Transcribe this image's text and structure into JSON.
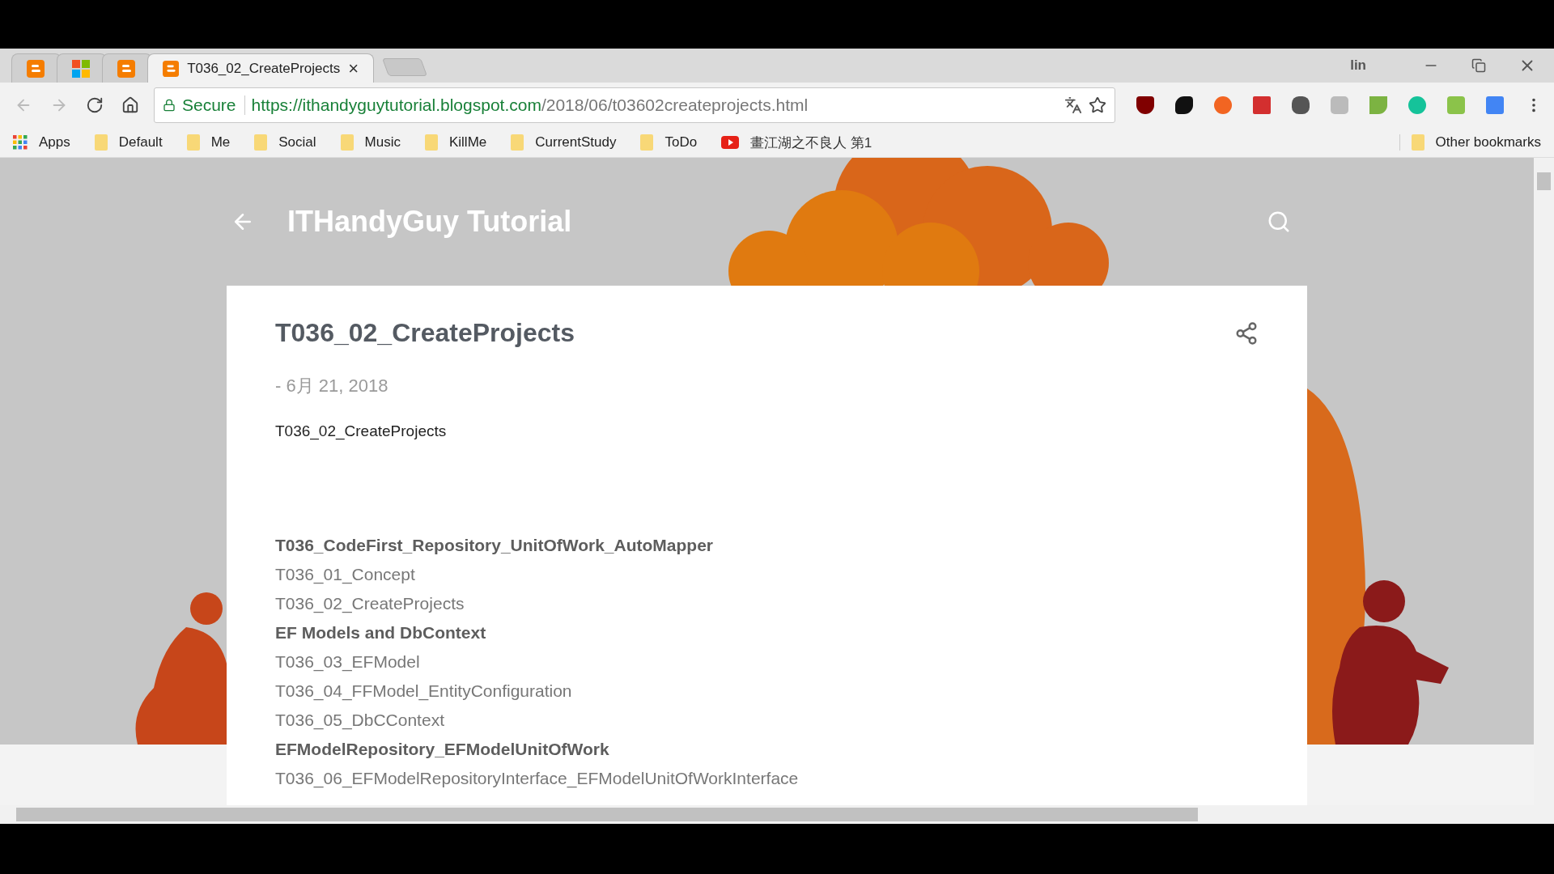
{
  "tabs": [
    {
      "kind": "icon",
      "selected": false
    },
    {
      "kind": "icon",
      "selected": false
    },
    {
      "kind": "icon",
      "selected": false
    },
    {
      "kind": "title",
      "title": "T036_02_CreateProjects",
      "close": "×",
      "selected": true
    }
  ],
  "profile": "lin",
  "address": {
    "secure_label": "Secure",
    "host": "https://ithandyguytutorial.blogspot.com",
    "path": "/2018/06/t03602createprojects.html"
  },
  "bookmarks": [
    {
      "kind": "apps",
      "label": "Apps"
    },
    {
      "kind": "folder",
      "label": "Default"
    },
    {
      "kind": "folder",
      "label": "Me"
    },
    {
      "kind": "folder",
      "label": "Social"
    },
    {
      "kind": "folder",
      "label": "Music"
    },
    {
      "kind": "folder",
      "label": "KillMe"
    },
    {
      "kind": "folder",
      "label": "CurrentStudy"
    },
    {
      "kind": "folder",
      "label": "ToDo"
    },
    {
      "kind": "video",
      "label": "畫江湖之不良人 第1"
    }
  ],
  "other_bookmarks": "Other bookmarks",
  "blog": {
    "title": "ITHandyGuy Tutorial"
  },
  "post": {
    "title": "T036_02_CreateProjects",
    "date": "- 6月 21, 2018",
    "intro": "T036_02_CreateProjects",
    "items": [
      {
        "kind": "heading",
        "text": "T036_CodeFirst_Repository_UnitOfWork_AutoMapper"
      },
      {
        "kind": "link",
        "text": "T036_01_Concept"
      },
      {
        "kind": "link",
        "text": "T036_02_CreateProjects"
      },
      {
        "kind": "heading",
        "text": "EF Models and DbContext"
      },
      {
        "kind": "link",
        "text": "T036_03_EFModel"
      },
      {
        "kind": "link",
        "text": "T036_04_FFModel_EntityConfiguration"
      },
      {
        "kind": "link",
        "text": "T036_05_DbCContext"
      },
      {
        "kind": "heading",
        "text": "EFModelRepository_EFModelUnitOfWork"
      },
      {
        "kind": "link",
        "text": "T036_06_EFModelRepositoryInterface_EFModelUnitOfWorkInterface"
      }
    ]
  }
}
